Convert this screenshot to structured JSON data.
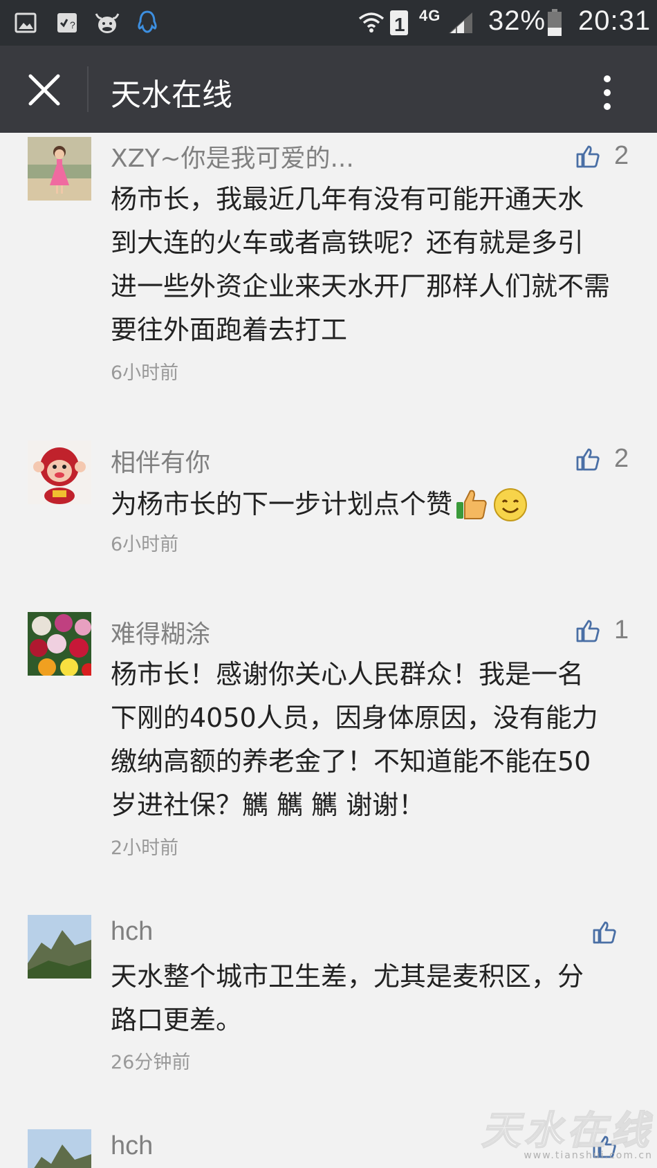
{
  "status_bar": {
    "icons": [
      "gallery-icon",
      "sim-toolkit-icon",
      "cow-app-icon",
      "qq-icon",
      "wifi-icon",
      "sim-1-icon",
      "signal-icon",
      "battery-icon"
    ],
    "network": "4G",
    "sim_label": "1",
    "battery": "32%",
    "time": "20:31"
  },
  "header": {
    "title": "天水在线"
  },
  "comments": [
    {
      "nickname": "XZY~你是我可爱的...",
      "likes": "2",
      "text_lines": [
        "杨市长，我最近几年有没有可能开通天水",
        "到大连的火车或者高铁呢？还有就是多引",
        "进一些外资企业来天水开厂那样人们就不需",
        "要往外面跑着去打工"
      ],
      "time": "6小时前"
    },
    {
      "nickname": "相伴有你",
      "likes": "2",
      "text": "为杨市长的下一步计划点个赞",
      "emojis": [
        "thumbs-up-emoji",
        "smile-emoji"
      ],
      "time": "6小时前"
    },
    {
      "nickname": "难得糊涂",
      "likes": "1",
      "text_lines": [
        "杨市长！感谢你关心人民群众！我是一名",
        "下刚的4050人员，因身体原因，没有能力",
        "缴纳高额的养老金了！不知道能不能在50",
        "岁进社保？觽 觽 觽 谢谢！"
      ],
      "time": "2小时前"
    },
    {
      "nickname": "hch",
      "likes": "",
      "text_lines": [
        "天水整个城市卫生差，尤其是麦积区，分",
        "路口更差。"
      ],
      "time": "26分钟前"
    },
    {
      "nickname": "hch"
    }
  ],
  "watermark": {
    "main": "天水在线",
    "sub": "www.tianshui.com.cn"
  },
  "colors": {
    "status_bar": "#2c2f33",
    "title_bar": "#393a3f",
    "background": "#f2f2f2",
    "like_icon": "#4a6fa5",
    "text": "#222222",
    "meta": "#808080"
  }
}
